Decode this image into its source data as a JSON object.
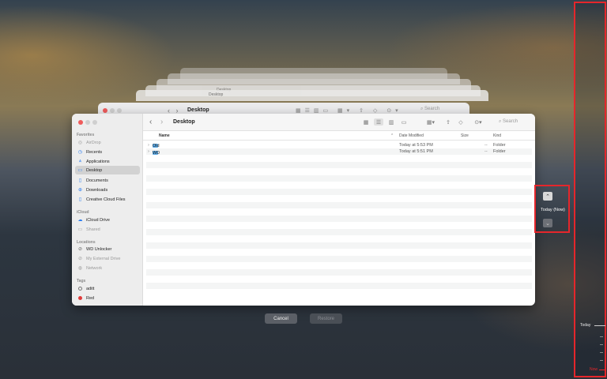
{
  "background_window_title": "Desktop",
  "ghost_title": "Desktop",
  "window": {
    "title": "Desktop",
    "search_placeholder": "Search"
  },
  "sidebar": {
    "sections": [
      {
        "title": "Favorites"
      },
      {
        "title": "iCloud"
      },
      {
        "title": "Locations"
      },
      {
        "title": "Tags"
      }
    ],
    "favorites": [
      {
        "label": "AirDrop",
        "icon": "airdrop-icon",
        "dim": true
      },
      {
        "label": "Recents",
        "icon": "clock-icon"
      },
      {
        "label": "Applications",
        "icon": "applications-icon"
      },
      {
        "label": "Desktop",
        "icon": "desktop-icon",
        "selected": true
      },
      {
        "label": "Documents",
        "icon": "document-icon"
      },
      {
        "label": "Downloads",
        "icon": "download-icon"
      },
      {
        "label": "Creative Cloud Files",
        "icon": "file-icon"
      }
    ],
    "icloud": [
      {
        "label": "iCloud Drive",
        "icon": "cloud-icon"
      },
      {
        "label": "Shared",
        "icon": "shared-folder-icon",
        "dim": true
      }
    ],
    "locations": [
      {
        "label": "WD Unlocker",
        "icon": "disk-icon"
      },
      {
        "label": "My External Drive",
        "icon": "disk-icon",
        "dim": true
      },
      {
        "label": "Network",
        "icon": "network-icon",
        "dim": true
      }
    ],
    "tags": [
      {
        "label": "aditt",
        "color": "#ffffff"
      },
      {
        "label": "Red",
        "color": "#e03b3b"
      }
    ]
  },
  "columns": {
    "name": "Name",
    "date_modified": "Date Modified",
    "size": "Size",
    "kind": "Kind"
  },
  "files": [
    {
      "name": "Old Desktop",
      "date": "Today at 5:53 PM",
      "size": "--",
      "kind": "Folder"
    },
    {
      "name": "WD",
      "date": "Today at 5:51 PM",
      "size": "--",
      "kind": "Folder"
    }
  ],
  "buttons": {
    "cancel": "Cancel",
    "restore": "Restore"
  },
  "time_nav": {
    "label": "Today (Now)"
  },
  "timeline": {
    "today_label": "Today",
    "now_label": "Now"
  }
}
